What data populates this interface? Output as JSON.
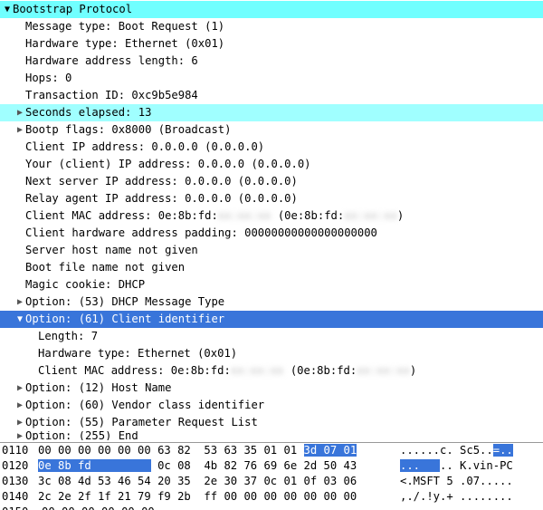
{
  "tree": {
    "root_label": "Bootstrap Protocol",
    "items": [
      {
        "lv": 1,
        "arrow": "none",
        "text": "Message type: Boot Request (1)"
      },
      {
        "lv": 1,
        "arrow": "none",
        "text": "Hardware type: Ethernet (0x01)"
      },
      {
        "lv": 1,
        "arrow": "none",
        "text": "Hardware address length: 6"
      },
      {
        "lv": 1,
        "arrow": "none",
        "text": "Hops: 0"
      },
      {
        "lv": 1,
        "arrow": "none",
        "text": "Transaction ID: 0xc9b5e984"
      },
      {
        "lv": 1,
        "arrow": "closed",
        "text": "Seconds elapsed: 13",
        "hl": "cyan-light"
      },
      {
        "lv": 1,
        "arrow": "closed",
        "text": "Bootp flags: 0x8000 (Broadcast)"
      },
      {
        "lv": 1,
        "arrow": "none",
        "text": "Client IP address: 0.0.0.0 (0.0.0.0)"
      },
      {
        "lv": 1,
        "arrow": "none",
        "text": "Your (client) IP address: 0.0.0.0 (0.0.0.0)"
      },
      {
        "lv": 1,
        "arrow": "none",
        "text": "Next server IP address: 0.0.0.0 (0.0.0.0)"
      },
      {
        "lv": 1,
        "arrow": "none",
        "text": "Relay agent IP address: 0.0.0.0 (0.0.0.0)"
      },
      {
        "lv": 1,
        "arrow": "none",
        "mac": true
      },
      {
        "lv": 1,
        "arrow": "none",
        "text": "Client hardware address padding: 00000000000000000000"
      },
      {
        "lv": 1,
        "arrow": "none",
        "text": "Server host name not given"
      },
      {
        "lv": 1,
        "arrow": "none",
        "text": "Boot file name not given"
      },
      {
        "lv": 1,
        "arrow": "none",
        "text": "Magic cookie: DHCP"
      },
      {
        "lv": 1,
        "arrow": "closed",
        "text": "Option: (53) DHCP Message Type"
      },
      {
        "lv": 1,
        "arrow": "open",
        "text": "Option: (61) Client identifier",
        "hl": "blue"
      },
      {
        "lv": 2,
        "arrow": "none",
        "text": "Length: 7"
      },
      {
        "lv": 2,
        "arrow": "none",
        "text": "Hardware type: Ethernet (0x01)"
      },
      {
        "lv": 2,
        "arrow": "none",
        "mac": true
      },
      {
        "lv": 1,
        "arrow": "closed",
        "text": "Option: (12) Host Name"
      },
      {
        "lv": 1,
        "arrow": "closed",
        "text": "Option: (60) Vendor class identifier"
      },
      {
        "lv": 1,
        "arrow": "closed",
        "text": "Option: (55) Parameter Request List"
      },
      {
        "lv": 1,
        "arrow": "closed",
        "text": "Option: (255) End",
        "partial": true
      }
    ],
    "mac_prefix": "Client MAC address: 0e:8b:fd:",
    "mac_redact": "xx:xx:xx",
    "mac_mid": " (0e:8b:fd:",
    "mac_redact2": "xx:xx:xx",
    "mac_suffix": ")"
  },
  "hex": {
    "rows": [
      {
        "offset": "0110",
        "pre": "00 00 00 00 00 00 63 82  53 63 35 01 01 ",
        "sel": "3d 07 01",
        "post": "",
        "ascii_pre": "......c. Sc5..",
        "ascii_sel": "=..",
        "ascii_post": ""
      },
      {
        "offset": "0120",
        "pre": "",
        "sel": "0e 8b fd         ",
        "post": " 0c 08  4b 82 76 69 6e 2d 50 43",
        "ascii_pre": "",
        "ascii_sel": "...   ",
        "ascii_post": ".. K.vin-PC"
      },
      {
        "offset": "0130",
        "pre": "3c 08 4d 53 46 54 20 35  2e 30 37 0c 01 0f 03 06",
        "sel": "",
        "post": "",
        "ascii_pre": "<.MSFT 5 .07.....",
        "ascii_sel": "",
        "ascii_post": ""
      },
      {
        "offset": "0140",
        "pre": "2c 2e 2f 1f 21 79 f9 2b  ff 00 00 00 00 00 00 00",
        "sel": "",
        "post": "",
        "ascii_pre": ",./.!y.+ ........",
        "ascii_sel": "",
        "ascii_post": ""
      }
    ]
  }
}
